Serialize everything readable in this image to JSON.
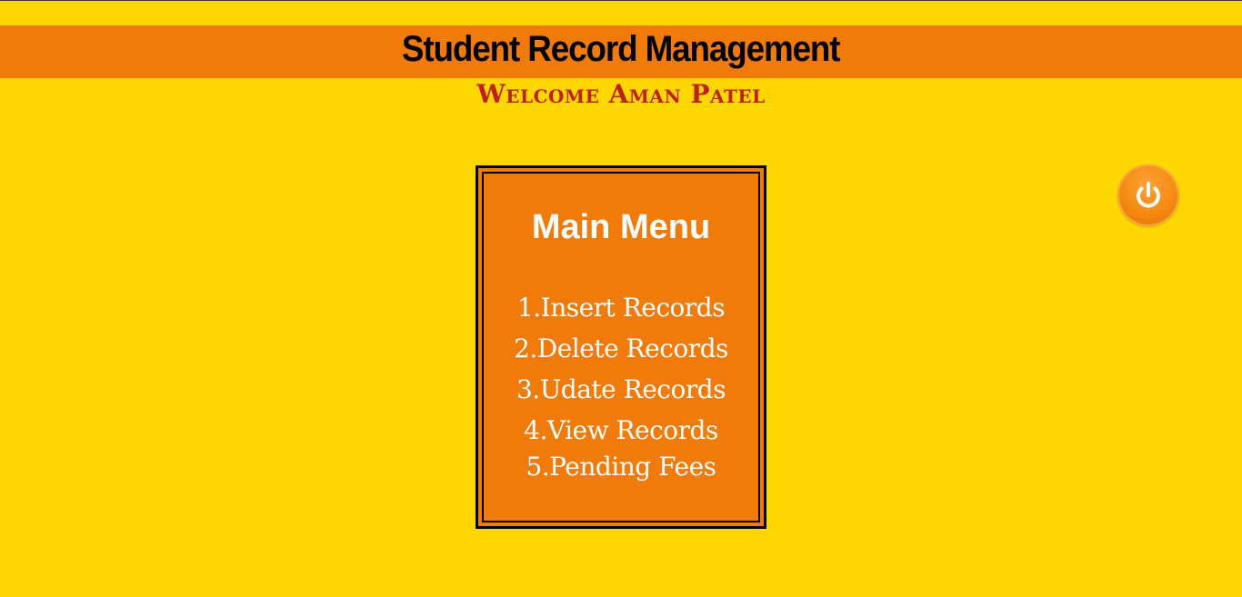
{
  "header": {
    "title": "Student Record Management"
  },
  "welcome_text": "Welcome Aman Patel",
  "menu": {
    "title": "Main Menu",
    "items": [
      {
        "label": "1.Insert Records"
      },
      {
        "label": "2.Delete Records"
      },
      {
        "label": "3.Udate Records"
      },
      {
        "label": "4.View Records"
      },
      {
        "label": "5.Pending Fees"
      }
    ]
  },
  "power_button": {
    "icon": "power-icon"
  },
  "colors": {
    "background": "#FFD700",
    "header_bar": "#F07A0A",
    "welcome_text": "#C0201A",
    "menu_box": "#F07A0A",
    "menu_text": "#FFFFFF"
  }
}
